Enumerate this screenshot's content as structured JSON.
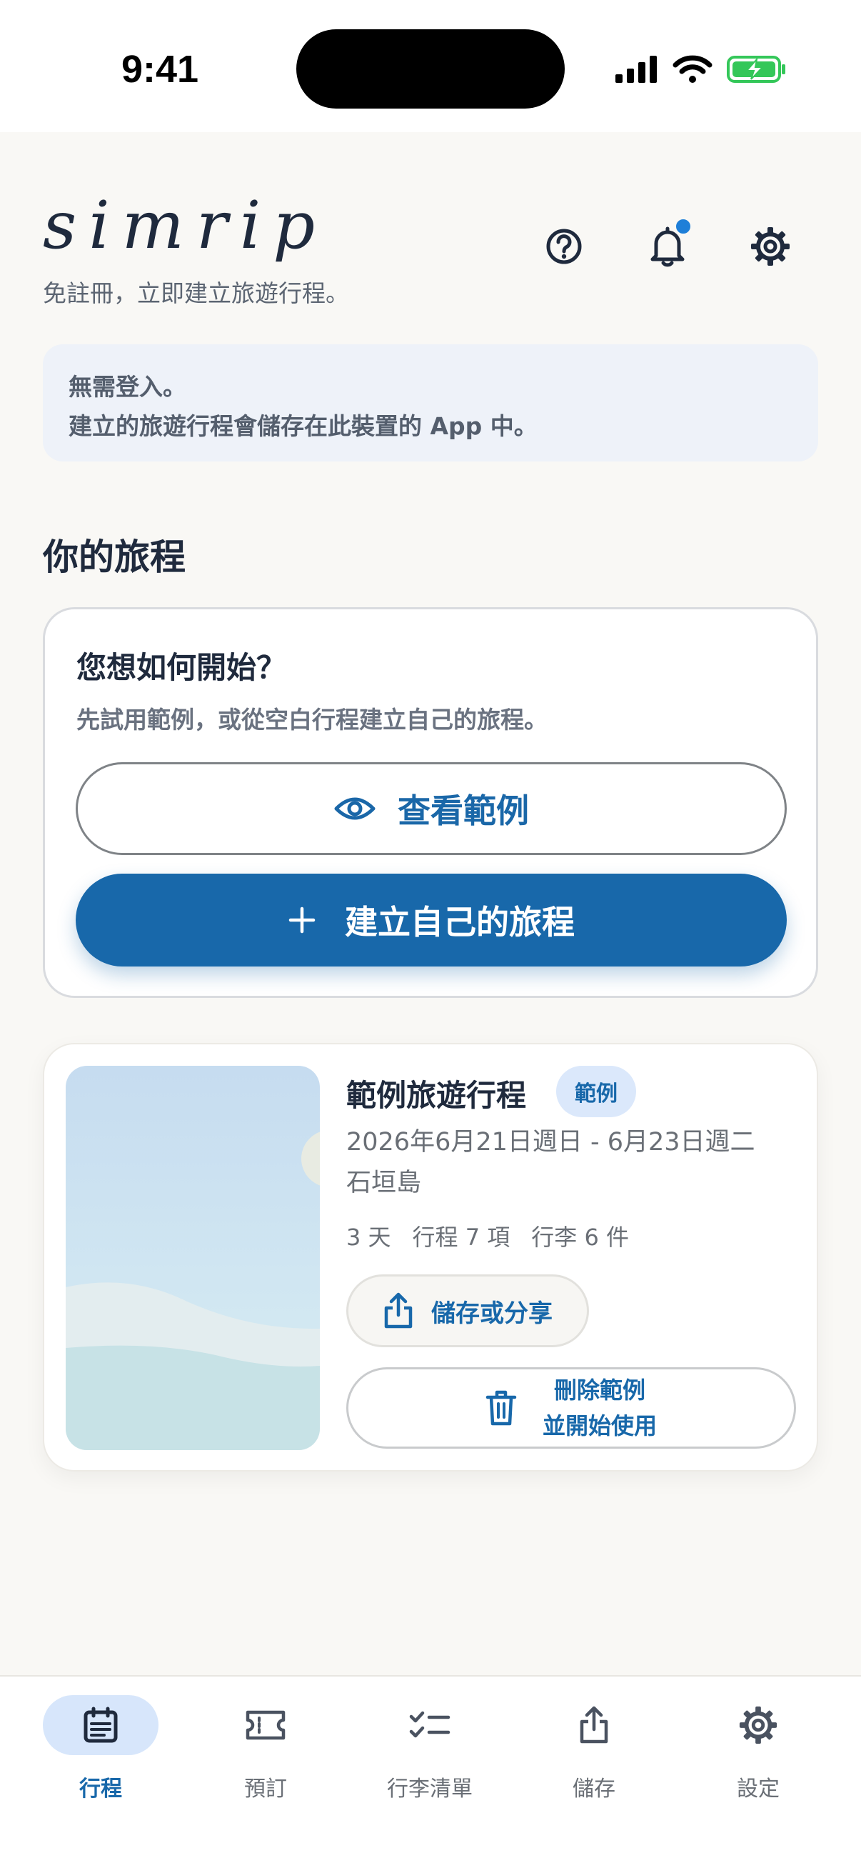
{
  "status_bar": {
    "time": "9:41"
  },
  "header": {
    "brand": "simrip",
    "tagline": "免註冊，立即建立旅遊行程。",
    "icons": [
      "help-icon",
      "bell-icon",
      "gear-icon"
    ]
  },
  "info": {
    "line1": "無需登入。",
    "line2": "建立的旅遊行程會儲存在此裝置的 App 中。"
  },
  "section_title": "你的旅程",
  "start_card": {
    "title": "您想如何開始？",
    "subtitle": "先試用範例，或從空白行程建立自己的旅程。",
    "view_example_label": "查看範例",
    "create_label": "建立自己的旅程"
  },
  "trip": {
    "title": "範例旅遊行程",
    "badge": "範例",
    "dates": "2026年6月21日週日 - 6月23日週二",
    "place": "石垣島",
    "days": "3 天",
    "plans": "行程 7 項",
    "luggage": "行李 6 件",
    "share_label": "儲存或分享",
    "delete_line1": "刪除範例",
    "delete_line2": "並開始使用"
  },
  "nav": [
    {
      "label": "行程",
      "icon": "calendar-icon",
      "active": true
    },
    {
      "label": "預訂",
      "icon": "ticket-icon",
      "active": false
    },
    {
      "label": "行李清單",
      "icon": "checklist-icon",
      "active": false
    },
    {
      "label": "儲存",
      "icon": "share-icon",
      "active": false
    },
    {
      "label": "設定",
      "icon": "gear-icon",
      "active": false
    }
  ],
  "colors": {
    "accent": "#1868aa",
    "background": "#f9f8f5",
    "notification_dot": "#1e7fd8",
    "battery": "#34c759"
  }
}
